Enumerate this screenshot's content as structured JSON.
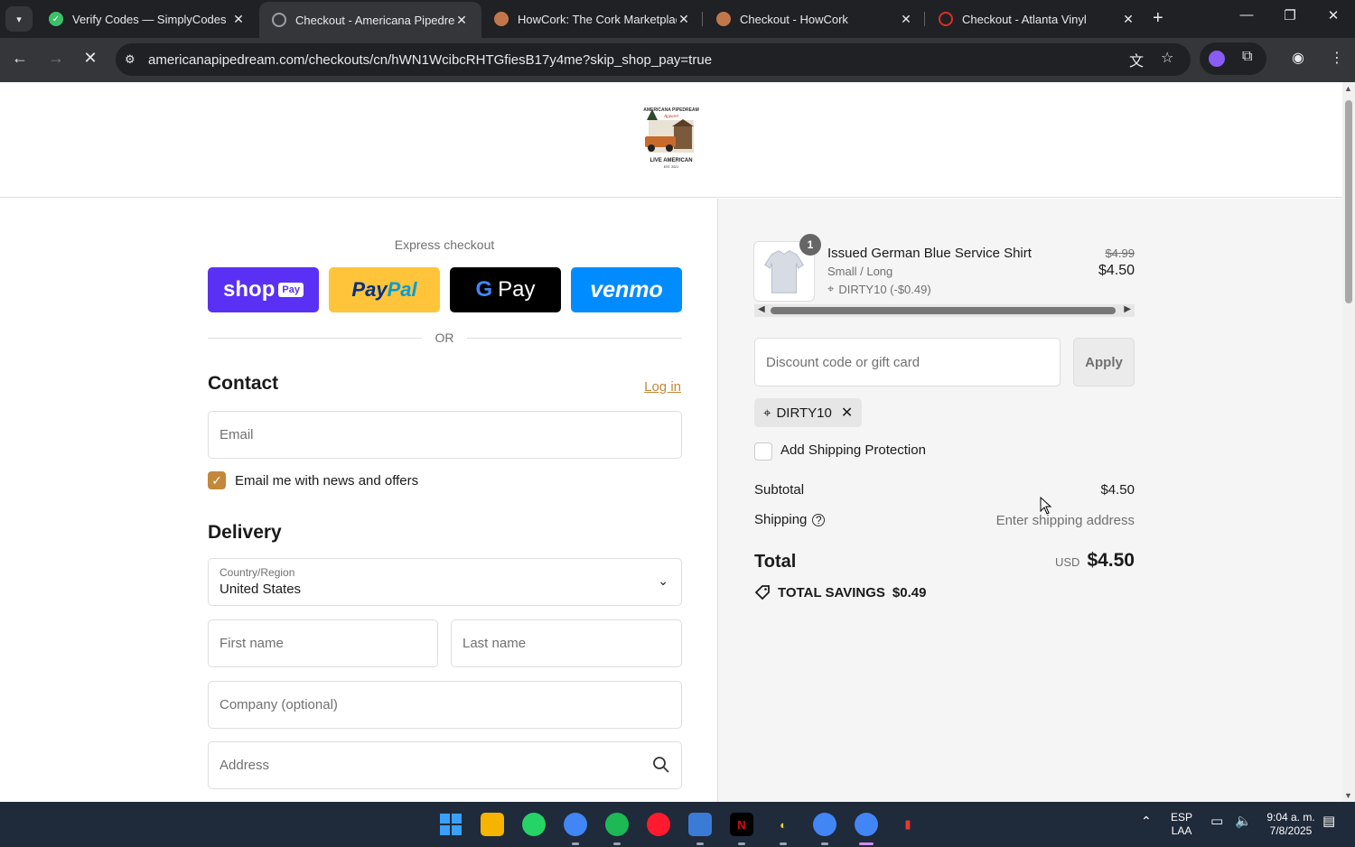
{
  "browser": {
    "tabs": [
      {
        "title": "Verify Codes — SimplyCodes",
        "active": false,
        "fav_color": "#3cc16a"
      },
      {
        "title": "Checkout - Americana Pipedrea",
        "active": true,
        "fav_color": "#9aa0a6"
      },
      {
        "title": "HowCork: The Cork Marketplac",
        "active": false,
        "fav_color": "#c2774b"
      },
      {
        "title": "Checkout - HowCork",
        "active": false,
        "fav_color": "#c2774b"
      },
      {
        "title": "Checkout - Atlanta Vinyl",
        "active": false,
        "fav_color": "#d93025"
      }
    ],
    "url": "americanapipedream.com/checkouts/cn/hWN1WcibcRHTGfiesB17y4me?skip_shop_pay=true"
  },
  "header": {
    "logo_top": "AMERICANA PIPEDREAM",
    "logo_mid": "Apparel",
    "logo_bottom": "LIVE AMERICAN",
    "logo_est": "EST. 2021"
  },
  "express": {
    "label": "Express checkout",
    "shop_pay": "shop",
    "shop_pay_badge": "Pay",
    "paypal_a": "Pay",
    "paypal_b": "Pal",
    "gpay_g": "G",
    "gpay_text": "Pay",
    "venmo": "venmo",
    "or": "OR"
  },
  "contact": {
    "heading": "Contact",
    "login": "Log in",
    "email_placeholder": "Email",
    "news_label": "Email me with news and offers",
    "news_checked": true
  },
  "delivery": {
    "heading": "Delivery",
    "country_label": "Country/Region",
    "country_value": "United States",
    "first_name": "First name",
    "last_name": "Last name",
    "company": "Company (optional)",
    "address": "Address"
  },
  "summary": {
    "item": {
      "qty": "1",
      "name": "Issued German Blue Service Shirt",
      "variant": "Small / Long",
      "discount": "DIRTY10 (-$0.49)",
      "old_price": "$4.99",
      "price": "$4.50"
    },
    "discount_placeholder": "Discount code or gift card",
    "apply": "Apply",
    "applied_code": "DIRTY10",
    "protection_label": "Add Shipping Protection",
    "subtotal_label": "Subtotal",
    "subtotal_value": "$4.50",
    "shipping_label": "Shipping",
    "shipping_value": "Enter shipping address",
    "total_label": "Total",
    "currency": "USD",
    "total_value": "$4.50",
    "savings_label": "TOTAL SAVINGS",
    "savings_value": "$0.49"
  },
  "taskbar": {
    "lang_top": "ESP",
    "lang_bottom": "LAA",
    "time": "9:04 a. m.",
    "date": "7/8/2025"
  },
  "colors": {
    "accent": "#c3883a",
    "shop_pay": "#5a31f4",
    "paypal": "#ffc439",
    "venmo": "#008cff"
  }
}
